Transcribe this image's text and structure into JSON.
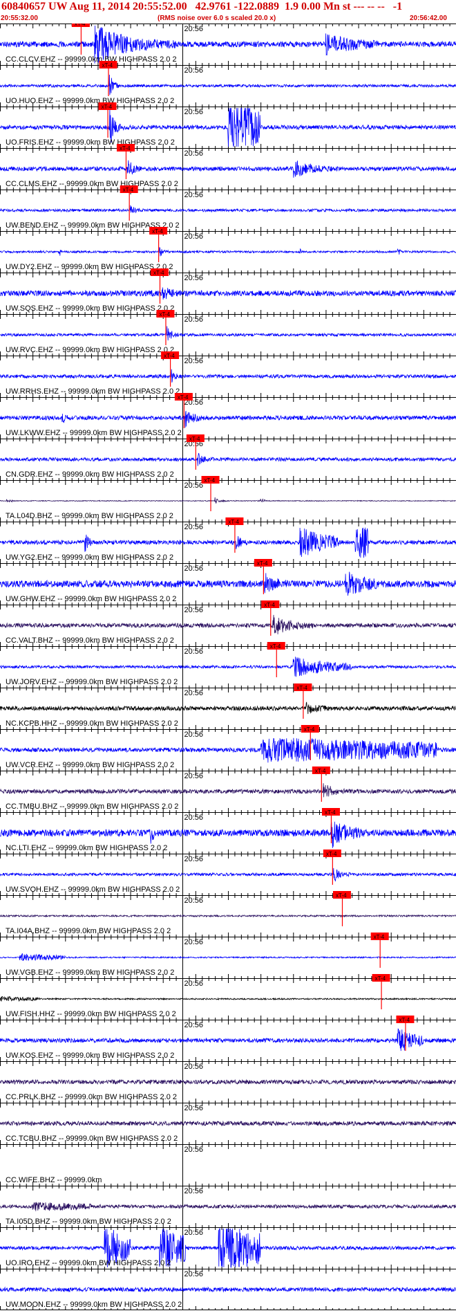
{
  "header": {
    "title": "60840657 UW Aug 11, 2014 20:55:52.00   42.9761 -122.0889  1.9 0.00 Mn st --- -- --   -1",
    "rms_note": "(RMS noise over 6.0 s scaled 20.0 x)",
    "start_time": "20:55:32.00",
    "end_time": "20:56:42.00"
  },
  "colors": {
    "accent": "#d00000",
    "pick_box": "#ff0000",
    "trace_blue": "#0000ff",
    "trace_dark": "#2a1060",
    "trace_black": "#000000"
  },
  "chart_data": {
    "type": "line",
    "time_range_s": [
      0,
      70
    ],
    "minute_marker_s": 28,
    "minute_label": "20:56",
    "pick_label": "xT-4",
    "traces": [
      {
        "label": "CC.CLCV.EHZ -- 99999.0km BW  HIGHPASS  2.0  2",
        "color": "blue",
        "pick_s": 12.4,
        "noise": 4,
        "bursts": [
          [
            14.5,
            27,
            26,
            0.9
          ],
          [
            50,
            58,
            12,
            0.6
          ]
        ]
      },
      {
        "label": "UO.HUO.EHZ -- 99999.0km BW  HIGHPASS  2.0  2",
        "color": "blue",
        "pick_s": 16.6,
        "noise": 2,
        "bursts": [
          [
            16.8,
            18.5,
            40,
            1.5
          ]
        ]
      },
      {
        "label": "UO.FRIS.EHZ -- 99999.0km BW  HIGHPASS  2.0  2",
        "color": "blue",
        "pick_s": 16.5,
        "noise": 3,
        "bursts": [
          [
            16.8,
            19,
            30,
            1.2
          ],
          [
            35,
            40,
            40,
            0.2
          ]
        ]
      },
      {
        "label": "CC.CLMS.EHZ -- 99999.0km BW  HIGHPASS  2.0  2",
        "color": "blue",
        "pick_s": 19.3,
        "noise": 3,
        "bursts": [
          [
            19.5,
            22,
            16,
            1.2
          ],
          [
            45,
            52,
            12,
            1
          ]
        ]
      },
      {
        "label": "UW.BEND.EHZ -- 99999.0km BW  HIGHPASS  2.0  2",
        "color": "blue",
        "pick_s": 19.8,
        "noise": 2,
        "bursts": [
          [
            20,
            22,
            6,
            1
          ]
        ]
      },
      {
        "label": "UW.DY2.EHZ -- 99999.0km BW  HIGHPASS  2.0  2",
        "color": "blue",
        "pick_s": 24.3,
        "noise": 1.5,
        "bursts": [
          [
            9,
            9.5,
            8,
            0.5
          ],
          [
            24.5,
            26,
            7,
            1
          ],
          [
            46,
            46.5,
            6,
            0.5
          ],
          [
            61,
            61.5,
            6,
            0.5
          ]
        ]
      },
      {
        "label": "UW.SQS.EHZ -- 99999.0km BW  HIGHPASS  2.0  2",
        "color": "blue",
        "pick_s": 24.5,
        "noise": 4,
        "bursts": [
          [
            24.8,
            30,
            9,
            1.5
          ]
        ]
      },
      {
        "label": "UW.RVC.EHZ -- 99999.0km BW  HIGHPASS  2.0  2",
        "color": "blue",
        "pick_s": 25.4,
        "noise": 2,
        "bursts": [
          [
            25.6,
            28,
            12,
            1.2
          ]
        ]
      },
      {
        "label": "UW.RRHS.EHZ -- 99999.0km BW  HIGHPASS  2.0  2",
        "color": "blue",
        "pick_s": 26.1,
        "noise": 2.5,
        "bursts": [
          [
            26.3,
            28,
            10,
            1.2
          ]
        ]
      },
      {
        "label": "UW.LKWW.EHZ -- 99999.0km BW  HIGHPASS  2.0  2",
        "color": "blue",
        "pick_s": 28.2,
        "noise": 3,
        "bursts": [
          [
            28.4,
            32,
            15,
            1.2
          ],
          [
            9.5,
            10.5,
            8,
            0.7
          ]
        ]
      },
      {
        "label": "CN.GDR.EHZ -- 99999.0km BW  HIGHPASS  2.0  2",
        "color": "blue",
        "pick_s": 30,
        "noise": 2.5,
        "bursts": [
          [
            30.3,
            33,
            8,
            1.2
          ]
        ]
      },
      {
        "label": "TA.L04D.BHZ -- 99999.0km BW  HIGHPASS  2.0  2",
        "color": "dark",
        "pick_s": 32.3,
        "noise": 0.6,
        "bursts": [
          [
            1,
            2,
            3,
            0.5
          ],
          [
            33,
            35,
            5,
            1
          ],
          [
            40,
            41,
            3,
            0.5
          ]
        ]
      },
      {
        "label": "UW.YG2.EHZ -- 99999.0km BW  HIGHPASS  2.0  2",
        "color": "blue",
        "pick_s": 36,
        "noise": 3,
        "bursts": [
          [
            13,
            14,
            16,
            0.7
          ],
          [
            36.2,
            38,
            12,
            1
          ],
          [
            46,
            52,
            20,
            0.4
          ],
          [
            54.5,
            56.5,
            24,
            0.1
          ]
        ]
      },
      {
        "label": "UW.GHW.EHZ -- 99999.0km BW  HIGHPASS  2.0  2",
        "color": "blue",
        "pick_s": 40.4,
        "noise": 5,
        "bursts": [
          [
            40.6,
            44,
            14,
            1
          ],
          [
            53,
            58,
            16,
            0.6
          ]
        ]
      },
      {
        "label": "CC.VALT.BHZ -- 99999.0km BW  HIGHPASS  2.0  2",
        "color": "dark",
        "pick_s": 41.5,
        "noise": 3,
        "bursts": [
          [
            41.8,
            48,
            14,
            0.8
          ]
        ]
      },
      {
        "label": "UW.JORV.EHZ -- 99999.0km BW  HIGHPASS  2.0  2",
        "color": "blue",
        "pick_s": 42.4,
        "noise": 2,
        "bursts": [
          [
            45,
            54,
            14,
            0.5
          ]
        ]
      },
      {
        "label": "NC.KCPB.HHZ -- 99999.0km BW  HIGHPASS  2.0  2",
        "color": "black",
        "pick_s": 46.5,
        "noise": 3,
        "bursts": [
          [
            47,
            51,
            8,
            1
          ]
        ]
      },
      {
        "label": "UW.VCR.EHZ -- 99999.0km BW  HIGHPASS  2.0  2",
        "color": "blue",
        "pick_s": 47.6,
        "noise": 3,
        "bursts": [
          [
            40,
            67,
            16,
            0.2
          ]
        ]
      },
      {
        "label": "CC.TMBU.BHZ -- 99999.0km BW  HIGHPASS  2.0  2",
        "color": "dark",
        "pick_s": 49.3,
        "noise": 3,
        "bursts": [
          [
            49.5,
            53,
            14,
            1
          ]
        ]
      },
      {
        "label": "NC.LTI.EHZ -- 99999.0km BW  HIGHPASS  2.0  2",
        "color": "blue",
        "pick_s": 50.8,
        "noise": 5,
        "bursts": [
          [
            23,
            24,
            14,
            0.6
          ],
          [
            50.8,
            56,
            20,
            0.8
          ]
        ]
      },
      {
        "label": "UW.SVOH.EHZ -- 99999.0km BW  HIGHPASS  2.0  2",
        "color": "blue",
        "pick_s": 51,
        "noise": 2,
        "bursts": [
          [
            51.2,
            54,
            12,
            1
          ]
        ]
      },
      {
        "label": "TA.I04A.BHZ -- 99999.0km BW  HIGHPASS  2.0  2",
        "color": "dark",
        "pick_s": 52.5,
        "noise": 1.2,
        "bursts": []
      },
      {
        "label": "UW.VGB.EHZ -- 99999.0km BW  HIGHPASS  2.0  2",
        "color": "blue",
        "pick_s": 58.3,
        "noise": 1,
        "bursts": [
          [
            3,
            10,
            5,
            0.3
          ]
        ]
      },
      {
        "label": "UW.FISH.HHZ -- 99999.0km BW  HIGHPASS  2.0  2",
        "color": "black",
        "pick_s": 58.5,
        "noise": 1,
        "bursts": [
          [
            0,
            6,
            3,
            0.3
          ]
        ]
      },
      {
        "label": "UW.KOS.EHZ -- 99999.0km BW  HIGHPASS  2.0  2",
        "color": "blue",
        "pick_s": 62.2,
        "noise": 3,
        "bursts": [
          [
            61,
            65,
            18,
            0.5
          ]
        ]
      },
      {
        "label": "CC.PRLK.BHZ -- 99999.0km BW  HIGHPASS  2.0  2",
        "color": "dark",
        "pick_s": null,
        "noise": 3,
        "bursts": []
      },
      {
        "label": "CC.TCBU.BHZ -- 99999.0km BW  HIGHPASS  2.0  2",
        "color": "dark",
        "pick_s": null,
        "noise": 3,
        "bursts": []
      },
      {
        "label": "CC.WIFE.BHZ -- 99999.0km",
        "color": "dark",
        "pick_s": null,
        "noise": 0,
        "bursts": []
      },
      {
        "label": "TA.I05D.BHZ -- 99999.0km BW  HIGHPASS  2.0  2",
        "color": "dark",
        "pick_s": null,
        "noise": 2.5,
        "bursts": [
          [
            5,
            14,
            5,
            0.3
          ]
        ]
      },
      {
        "label": "UO.IRO.EHZ -- 99999.0km BW  HIGHPASS  2.0  2",
        "color": "blue",
        "pick_s": null,
        "noise": 2.5,
        "bursts": [
          [
            16,
            20,
            30,
            0.2
          ],
          [
            24.5,
            28.5,
            32,
            0.2
          ],
          [
            33.5,
            40,
            34,
            0.15
          ]
        ]
      },
      {
        "label": "UW.MOON.EHZ -- 99999.0km BW  HIGHPASS  2.0  2",
        "color": "blue",
        "pick_s": null,
        "noise": 3,
        "bursts": []
      }
    ]
  }
}
